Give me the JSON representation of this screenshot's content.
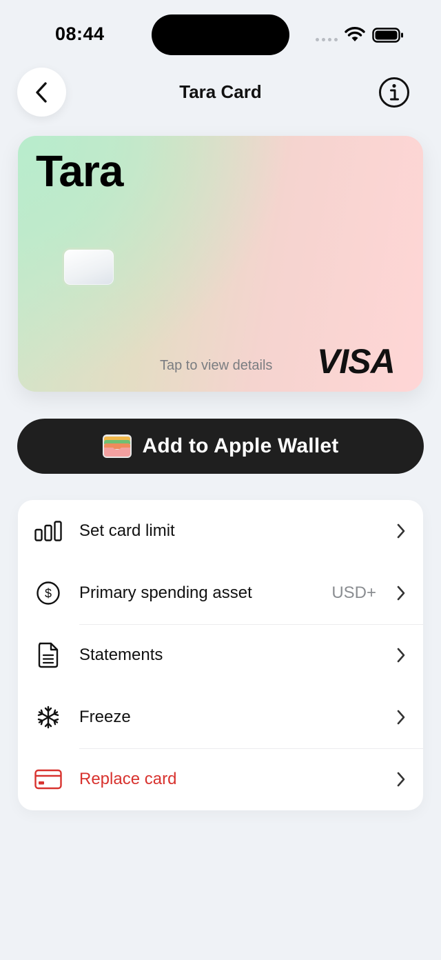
{
  "status_bar": {
    "time": "08:44"
  },
  "header": {
    "title": "Tara Card"
  },
  "card": {
    "brand": "Tara",
    "hint": "Tap to view details",
    "network": "VISA"
  },
  "wallet_button": {
    "label": "Add to Apple Wallet"
  },
  "menu": {
    "items": [
      {
        "label": "Set card limit",
        "icon": "bar-chart-icon"
      },
      {
        "label": "Primary spending asset",
        "value": "USD+",
        "icon": "dollar-circle-icon"
      },
      {
        "label": "Statements",
        "icon": "document-icon"
      },
      {
        "label": "Freeze",
        "icon": "snowflake-icon"
      },
      {
        "label": "Replace card",
        "icon": "credit-card-icon",
        "color": "#d8322e"
      }
    ]
  },
  "colors": {
    "background": "#eff2f6",
    "wallet_button": "#1f1f1f",
    "danger": "#d8322e"
  }
}
